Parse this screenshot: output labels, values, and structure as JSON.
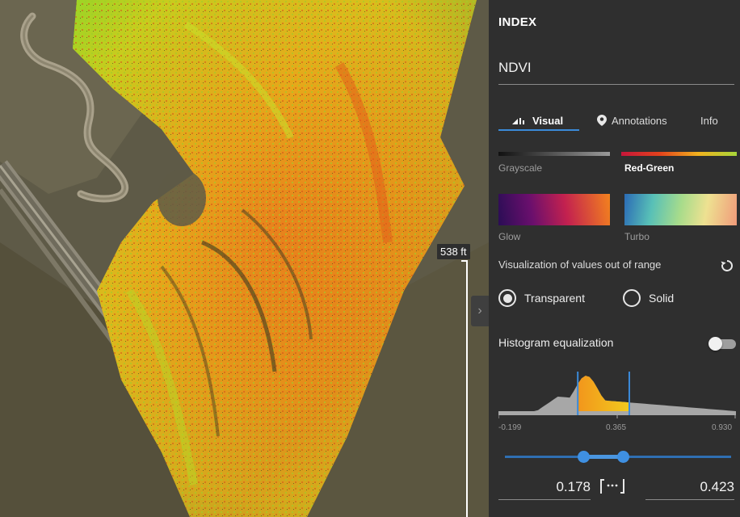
{
  "map": {
    "scale_label": "538 ft",
    "collapse_icon": "chevron-right-icon"
  },
  "panel": {
    "title": "INDEX",
    "index_value": "NDVI",
    "tabs": [
      {
        "label": "Visual",
        "icon": "bar-chart-icon",
        "active": true
      },
      {
        "label": "Annotations",
        "icon": "map-pin-icon",
        "active": false
      },
      {
        "label": "Info",
        "icon": "",
        "active": false
      }
    ],
    "palettes": [
      {
        "label": "Grayscale",
        "active": false
      },
      {
        "label": "Red-Green",
        "active": true
      },
      {
        "label": "Glow",
        "active": false
      },
      {
        "label": "Turbo",
        "active": false
      }
    ],
    "out_of_range": {
      "label": "Visualization of values out of range",
      "reset_icon": "reset-icon",
      "options": [
        {
          "label": "Transparent",
          "selected": true
        },
        {
          "label": "Solid",
          "selected": false
        }
      ]
    },
    "histogram": {
      "label": "Histogram equalization",
      "enabled": false,
      "min_label": "-0.199",
      "mid_label": "0.365",
      "max_label": "0.930",
      "range_min": -0.199,
      "range_max": 0.93,
      "selected_low": 0.178,
      "selected_high": 0.423
    },
    "range_values": {
      "low": "0.178",
      "high": "0.423",
      "mode_icon": "range-bracket-icon"
    },
    "colors": {
      "accent": "#3b8ad9",
      "panel_bg": "#2f2f2f"
    }
  }
}
